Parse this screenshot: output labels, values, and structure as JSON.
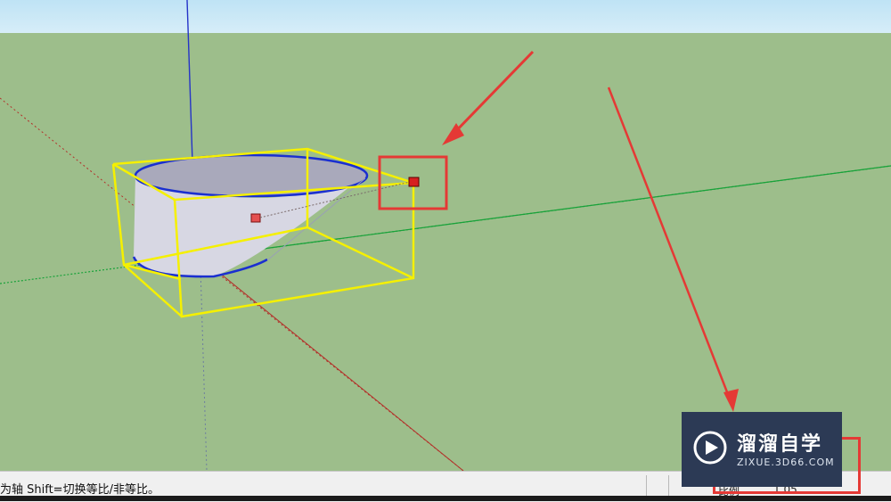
{
  "statusbar": {
    "hint": "为轴 Shift=切换等比/非等比。",
    "value_label": "比例",
    "value_input": "1.05"
  },
  "watermark": {
    "title": "溜溜自学",
    "subtitle": "ZIXUE.3D66.COM"
  },
  "colors": {
    "ground": "#9dbe8b",
    "sky": "#cfe9f6",
    "selection_box": "#f5f000",
    "edge_blue": "#1a2fd0",
    "axis_green": "#19a23a",
    "axis_red": "#b3302a",
    "axis_blue": "#2533c8",
    "annotation_red": "#e53935",
    "grip_red": "#d62020"
  },
  "icons": {
    "scale_grip": "red-cube-icon",
    "logo": "play-circle-icon"
  }
}
